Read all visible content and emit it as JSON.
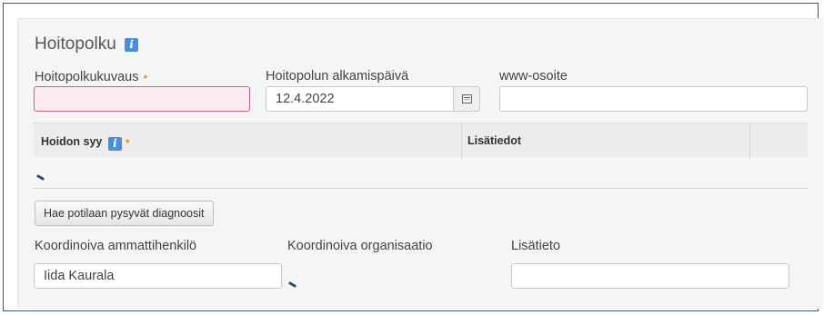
{
  "section": {
    "title": "Hoitopolku",
    "info_icon": "info-icon"
  },
  "fields": {
    "kuvaus": {
      "label": "Hoitopolkukuvaus",
      "required_mark": "•",
      "value": ""
    },
    "alkamispaiva": {
      "label": "Hoitopolun alkamispäivä",
      "value": "12.4.2022",
      "icon": "calendar-icon"
    },
    "www": {
      "label": "www-osoite",
      "value": ""
    }
  },
  "table": {
    "columns": [
      {
        "label": "Hoidon syy",
        "required_mark": "•",
        "info_icon": "info-icon"
      },
      {
        "label": "Lisätiedot"
      },
      {
        "label": ""
      }
    ]
  },
  "actions": {
    "fetch_diagnoses": "Hae potilaan pysyvät diagnoosit"
  },
  "coordination": {
    "professional": {
      "label": "Koordinoiva ammattihenkilö",
      "value": "Iida Kaurala"
    },
    "organisation": {
      "label": "Koordinoiva organisaatio",
      "loading_icon": "loading-icon"
    },
    "lisatieto": {
      "label": "Lisätieto",
      "value": ""
    }
  },
  "colors": {
    "frame": "#2f5f8f",
    "required": "#f39c12",
    "invalid_border": "#d9578a",
    "invalid_bg": "#fdebf1",
    "info": "#4a90d9"
  }
}
